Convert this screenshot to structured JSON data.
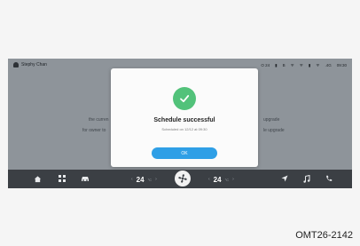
{
  "status_bar": {
    "user_name": "Stephy Chan",
    "items": [
      "O 24",
      "▮",
      "B",
      "ᯤ",
      "ᯤ",
      "▮",
      "ᯤ",
      ".4G",
      "09:30"
    ]
  },
  "background": {
    "line1_left": "the curren",
    "line2_left": "for owner to",
    "line1_right": "upgrade",
    "line2_right": "le upgrade"
  },
  "dialog": {
    "title": "Schedule successful",
    "subtitle": "Scheduled on 12/12 at 09:30",
    "ok_label": "OK"
  },
  "dock": {
    "left_temp": "24",
    "right_temp": "24",
    "temp_arrow_left": "‹",
    "temp_arrow_right": "›",
    "degree": "°C"
  },
  "caption": "OMT26-2142",
  "colors": {
    "accent": "#2f9fe6",
    "success": "#52c27a",
    "dock": "#3b3f44"
  }
}
